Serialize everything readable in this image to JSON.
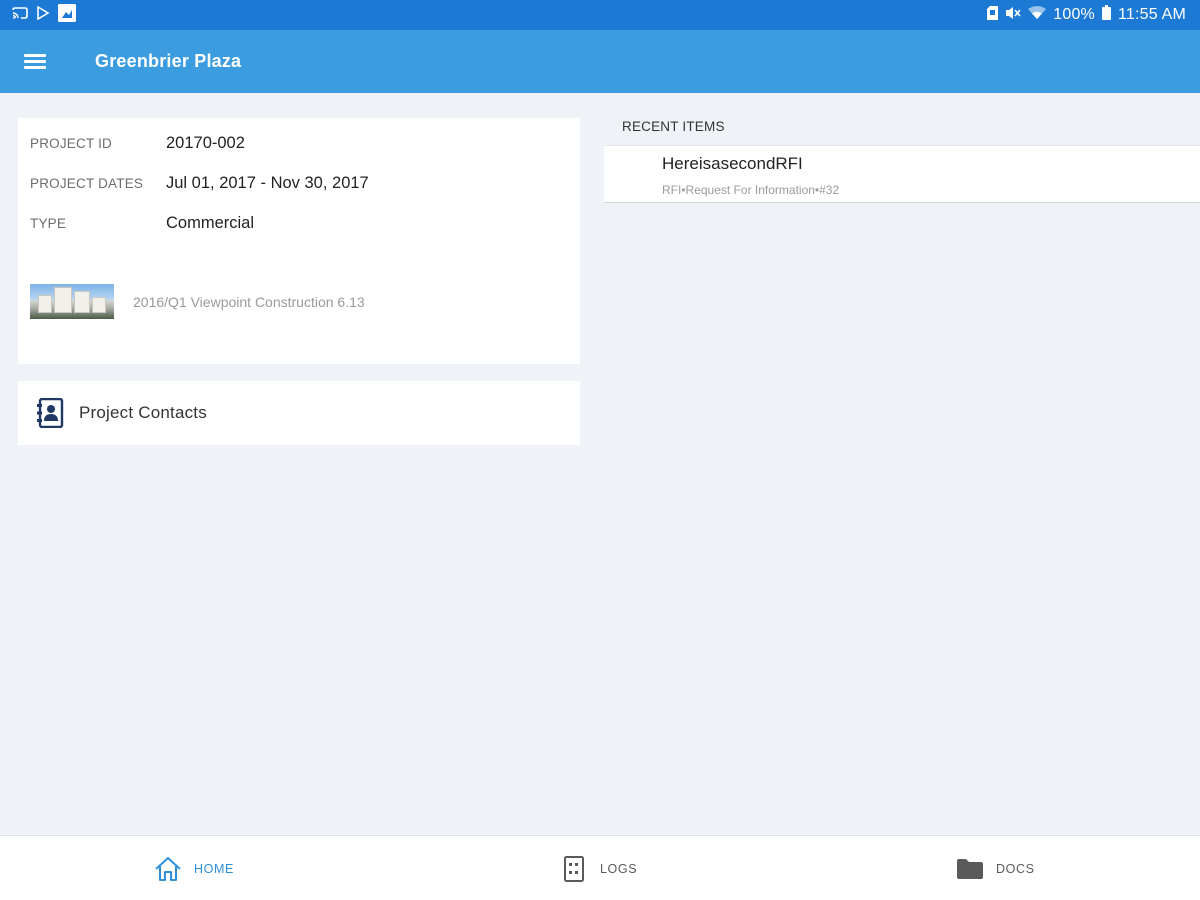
{
  "status_bar": {
    "icons": [
      "cast-icon",
      "play-icon",
      "gallery-icon",
      "sd-card-icon",
      "mute-icon",
      "wifi-icon",
      "battery-icon"
    ],
    "battery": "100%",
    "time": "11:55 AM"
  },
  "app_bar": {
    "menu_icon": "hamburger-menu-icon",
    "title": "Greenbrier Plaza"
  },
  "project": {
    "id_label": "PROJECT ID",
    "id_value": "20170-002",
    "dates_label": "PROJECT DATES",
    "dates_value": "Jul 01, 2017 - Nov 30, 2017",
    "type_label": "TYPE",
    "type_value": "Commercial",
    "photo_caption": "2016/Q1 Viewpoint Construction 6.13"
  },
  "contacts": {
    "icon": "contacts-book-icon",
    "label": "Project Contacts"
  },
  "recent": {
    "header": "RECENT ITEMS",
    "items": [
      {
        "title": "HereisasecondRFI",
        "subtitle": "RFI•Request For Information•#32"
      }
    ]
  },
  "bottom_nav": {
    "items": [
      {
        "label": "HOME",
        "icon": "home-icon",
        "active": true
      },
      {
        "label": "LOGS",
        "icon": "logs-icon",
        "active": false
      },
      {
        "label": "DOCS",
        "icon": "folder-icon",
        "active": false
      }
    ]
  },
  "colors": {
    "status_bar": "#1c7ad4",
    "app_bar": "#3b9de0",
    "background": "#eff3f8",
    "active_nav": "#2e8fd6",
    "contacts_icon": "#1f3864"
  }
}
